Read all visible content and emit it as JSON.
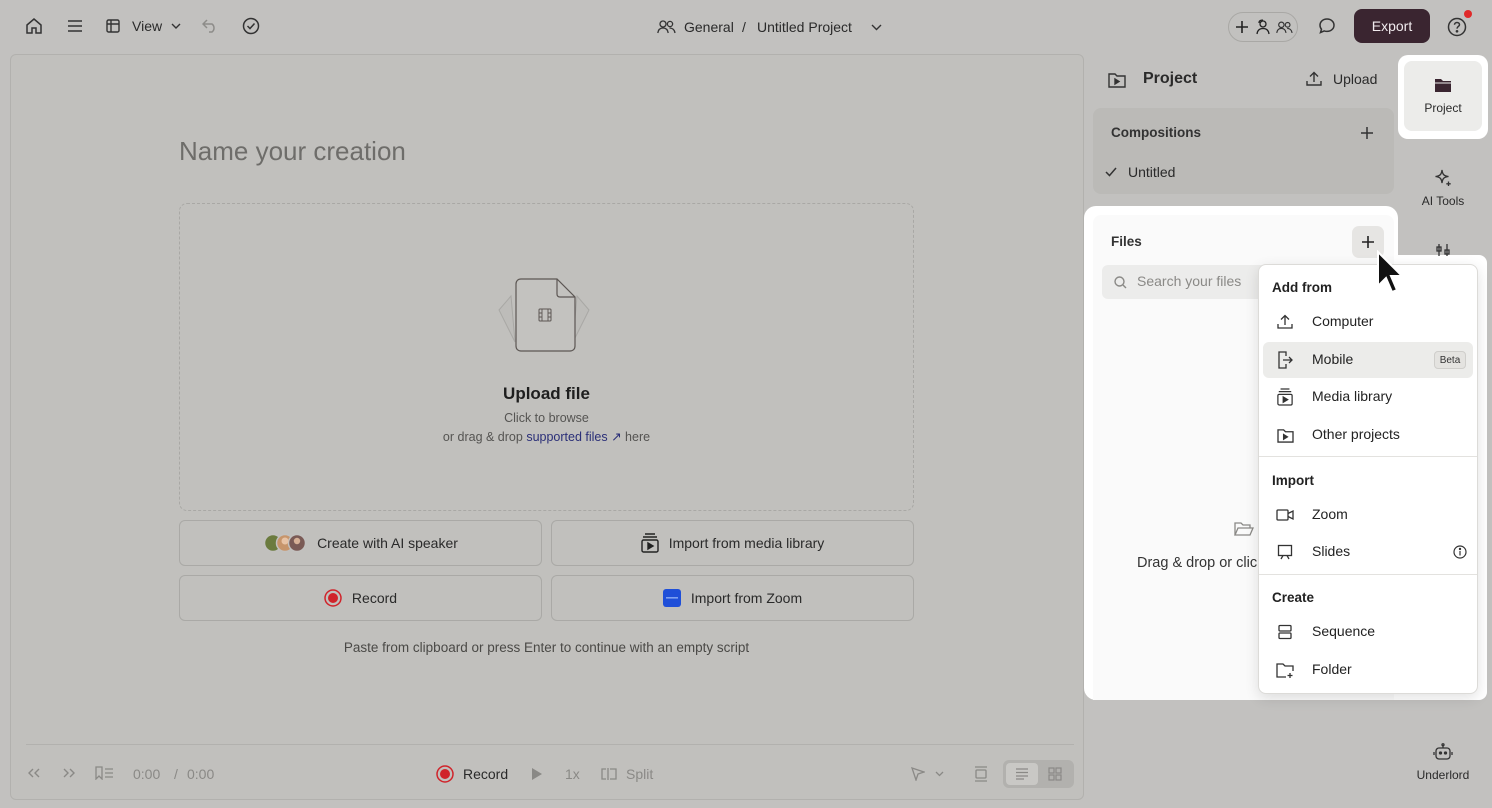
{
  "topbar": {
    "view_label": "View",
    "breadcrumb_workspace": "General",
    "breadcrumb_separator": "/",
    "breadcrumb_project": "Untitled Project",
    "export_label": "Export"
  },
  "editor": {
    "name_placeholder": "Name your creation",
    "upload_title": "Upload file",
    "upload_line1": "Click to browse",
    "upload_line2_prefix": "or drag & drop ",
    "upload_link": "supported files ↗",
    "upload_line2_suffix": " here",
    "buttons": {
      "ai_speaker": "Create with AI speaker",
      "import_media": "Import from media library",
      "record": "Record",
      "import_zoom": "Import from Zoom"
    },
    "paste_hint": "Paste from clipboard or press Enter to continue with an empty script"
  },
  "bottombar": {
    "time_current": "0:00",
    "time_separator": "/",
    "time_total": "0:00",
    "record_label": "Record",
    "speed": "1x",
    "split_label": "Split"
  },
  "panel": {
    "title": "Project",
    "upload_label": "Upload",
    "compositions_title": "Compositions",
    "composition_item": "Untitled",
    "files_title": "Files",
    "search_placeholder": "Search your files",
    "dropzone_text": "Drag & drop or clic"
  },
  "sidebar": {
    "project": "Project",
    "ai_tools": "AI Tools",
    "underlord": "Underlord"
  },
  "menu": {
    "section_add": "Add from",
    "computer": "Computer",
    "mobile": "Mobile",
    "beta": "Beta",
    "media_library": "Media library",
    "other_projects": "Other projects",
    "section_import": "Import",
    "zoom": "Zoom",
    "slides": "Slides",
    "section_create": "Create",
    "sequence": "Sequence",
    "folder": "Folder"
  },
  "colors": {
    "overlay_bg": "#c2c1bf",
    "export_bg": "#3a2530",
    "link": "#2b2f78",
    "record_red": "#d0232a",
    "zoom_blue": "#1f4fd8",
    "notification_red": "#e02929"
  }
}
